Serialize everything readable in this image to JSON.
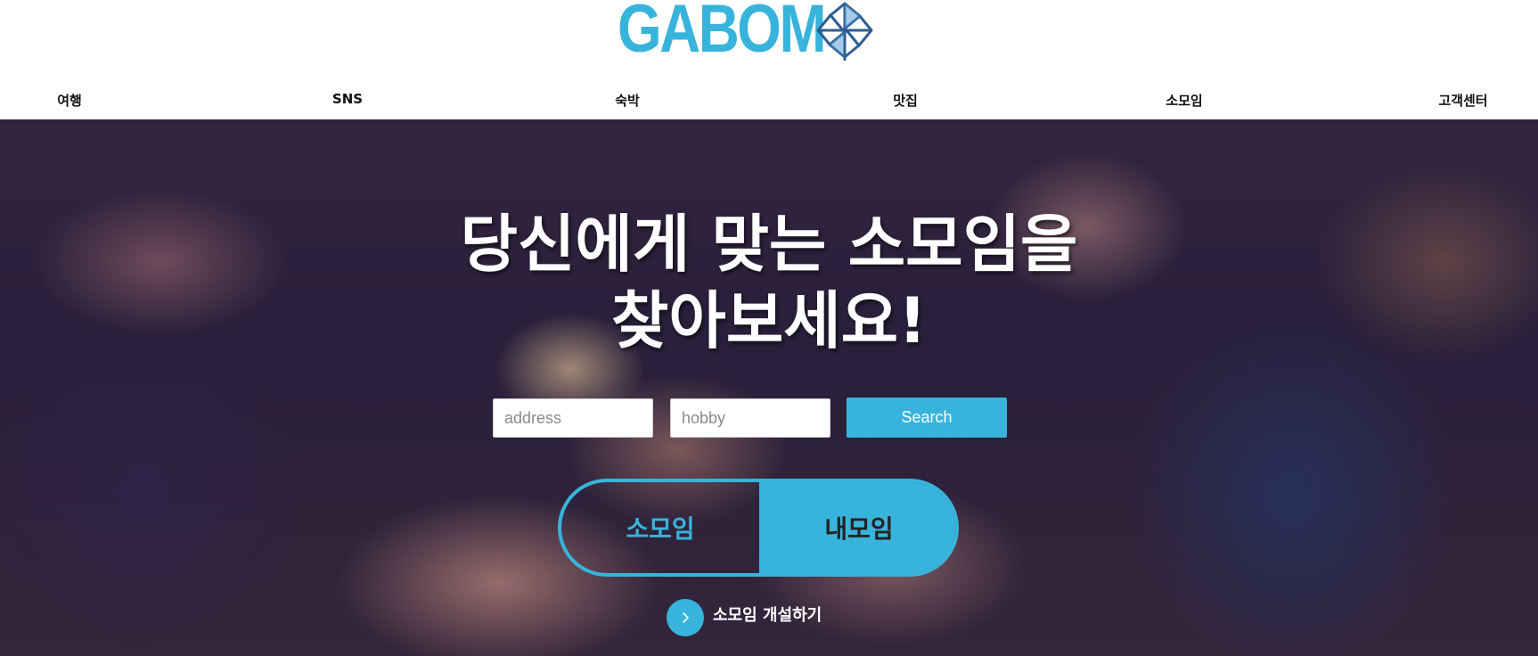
{
  "brand": {
    "logo_text": "GABOM",
    "logo_icon": "pinwheel-icon",
    "accent_color": "#38b4dc"
  },
  "nav": {
    "items": [
      {
        "label": "여행"
      },
      {
        "label": "SNS"
      },
      {
        "label": "숙박"
      },
      {
        "label": "맛집"
      },
      {
        "label": "소모임"
      },
      {
        "label": "고객센터"
      }
    ]
  },
  "hero": {
    "headline_line1": "당신에게 맞는 소모임을",
    "headline_line2": "찾아보세요!",
    "search": {
      "address_placeholder": "address",
      "hobby_placeholder": "hobby",
      "button_label": "Search"
    },
    "toggle": {
      "left_label": "소모임",
      "right_label": "내모임"
    },
    "create": {
      "icon": "chevron-right-icon",
      "label": "소모임 개설하기"
    }
  }
}
